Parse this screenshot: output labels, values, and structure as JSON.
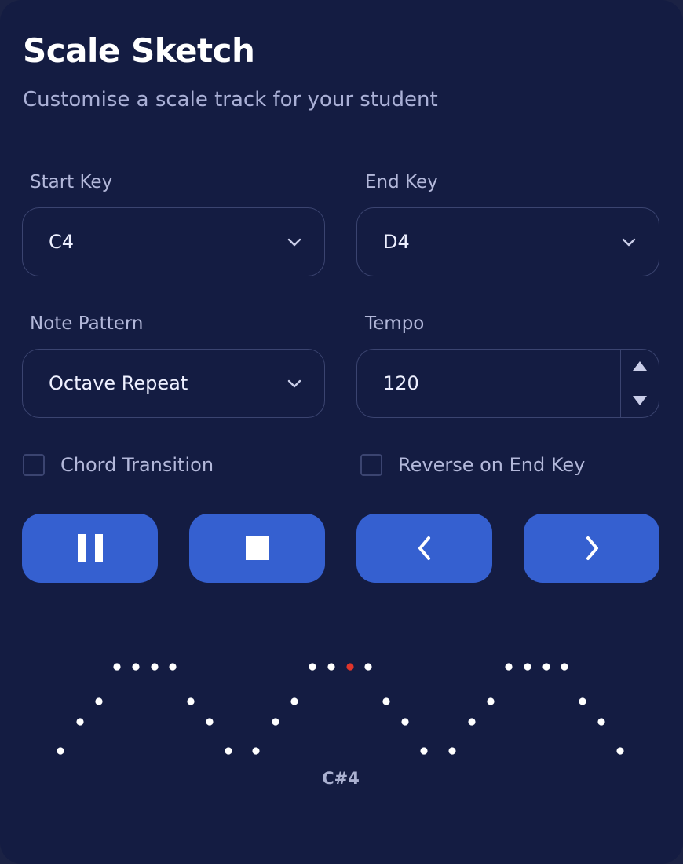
{
  "header": {
    "title": "Scale Sketch",
    "subtitle": "Customise a scale track for your student"
  },
  "fields": {
    "start_key": {
      "label": "Start Key",
      "value": "C4"
    },
    "end_key": {
      "label": "End Key",
      "value": "D4"
    },
    "note_pattern": {
      "label": "Note Pattern",
      "value": "Octave Repeat"
    },
    "tempo": {
      "label": "Tempo",
      "value": "120"
    }
  },
  "options": {
    "chord_transition": {
      "label": "Chord Transition",
      "checked": false
    },
    "reverse_on_end_key": {
      "label": "Reverse on End Key",
      "checked": false
    }
  },
  "controls": {
    "buttons": [
      "pause-icon",
      "stop-icon",
      "chevron-left-icon",
      "chevron-right-icon"
    ]
  },
  "visualizer": {
    "current_note": "C#4",
    "dot_color": "#ffffff",
    "active_color": "#e0352b"
  },
  "colors": {
    "background": "#141c42",
    "accent": "#3560d0"
  }
}
